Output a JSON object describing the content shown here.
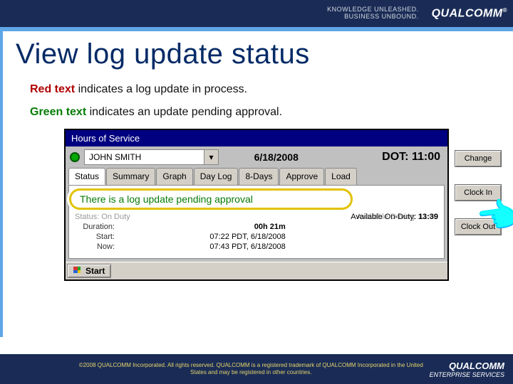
{
  "header": {
    "knowledge_line1": "KNOWLEDGE UNLEASHED.",
    "knowledge_line2": "BUSINESS UNBOUND.",
    "brand": "QUALCOMM"
  },
  "slide": {
    "title": "View log update status",
    "line1_strong": "Red text",
    "line1_rest": " indicates a log update in process.",
    "line2_strong": "Green text",
    "line2_rest": " indicates an update pending approval."
  },
  "app": {
    "title": "Hours of Service",
    "driver_name": "JOHN SMITH",
    "date": "6/18/2008",
    "dot_label": "DOT: ",
    "dot_time": "11:00",
    "tabs": [
      "Status",
      "Summary",
      "Graph",
      "Day Log",
      "8-Days",
      "Approve",
      "Load"
    ],
    "callout_text": "There is a log update pending approval",
    "obscured_left": "Status: On Duty",
    "obscured_right": "Available Driving: 11:00",
    "duration_label": "Duration:",
    "duration_value": "00h 21m",
    "avail_on_label": "Available On-Duty: ",
    "avail_on_value": "13:39",
    "start_label": "Start:",
    "start_value": "07:22 PDT, 6/18/2008",
    "now_label": "Now:",
    "now_value": "07:43 PDT, 6/18/2008",
    "buttons": {
      "change": "Change",
      "clock_in": "Clock In",
      "clock_out": "Clock Out"
    },
    "start_button": "Start"
  },
  "footer": {
    "note": "©2008 QUALCOMM Incorporated. All rights reserved. QUALCOMM is a registered trademark of QUALCOMM Incorporated in the United States and may be registered in other countries.",
    "brand": "QUALCOMM",
    "sub": "ENTERPRISE SERVICES"
  }
}
